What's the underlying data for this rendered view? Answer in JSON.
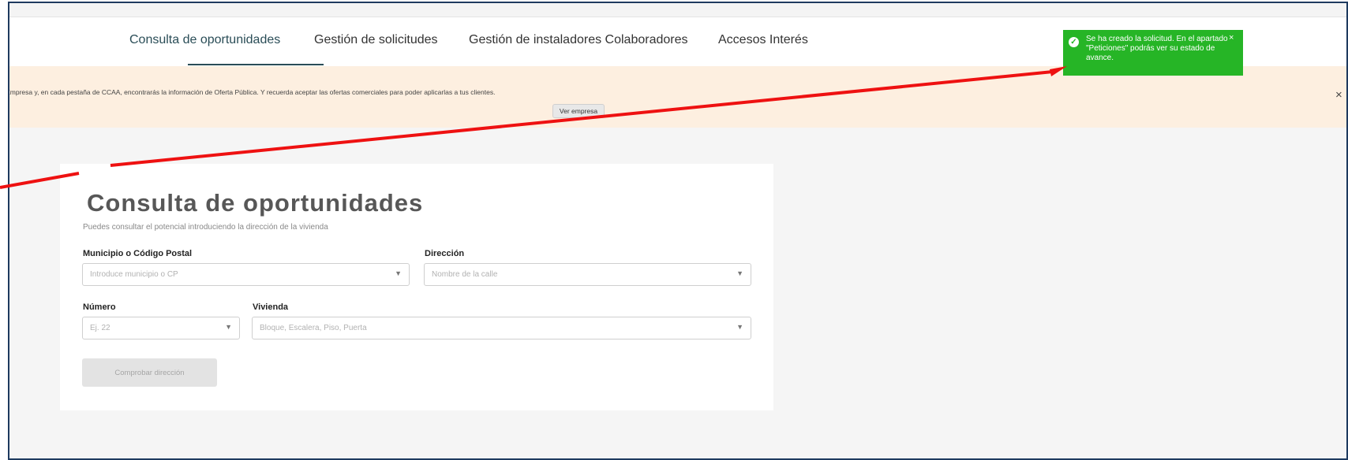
{
  "nav": {
    "tabs": [
      {
        "label": "Consulta de oportunidades",
        "active": true
      },
      {
        "label": "Gestión de solicitudes",
        "active": false
      },
      {
        "label": "Gestión de instaladores Colaboradores",
        "active": false
      },
      {
        "label": "Accesos Interés",
        "active": false
      }
    ]
  },
  "banner": {
    "text": "e Empresa y, en cada pestaña de CCAA, encontrarás la información de Oferta Pública. Y recuerda aceptar las ofertas comerciales para poder aplicarlas a tus clientes.",
    "button": "Ver empresa",
    "close": "×"
  },
  "form": {
    "title": "Consulta de oportunidades",
    "subtitle": "Puedes consultar el potencial introduciendo la dirección de la vivienda",
    "municipio": {
      "label": "Municipio o Código Postal",
      "placeholder": "Introduce municipio o CP"
    },
    "direccion": {
      "label": "Dirección",
      "placeholder": "Nombre de la calle"
    },
    "numero": {
      "label": "Número",
      "placeholder": "Ej. 22"
    },
    "vivienda": {
      "label": "Vivienda",
      "placeholder": "Bloque, Escalera, Piso, Puerta"
    },
    "submit": "Comprobar dirección"
  },
  "toast": {
    "message": "Se ha creado la solicitud. En el apartado \"Peticiones\" podrás ver su estado de avance.",
    "close": "×"
  },
  "icons": {
    "caret": "caret-down-icon",
    "check": "check-circle-icon",
    "close": "close-icon"
  },
  "colors": {
    "active_tab": "#2a4d57",
    "banner_bg": "#fdefe0",
    "toast_bg": "#26b526",
    "annotation_arrow": "#ee1111",
    "frame_border": "#1e3a5f"
  }
}
